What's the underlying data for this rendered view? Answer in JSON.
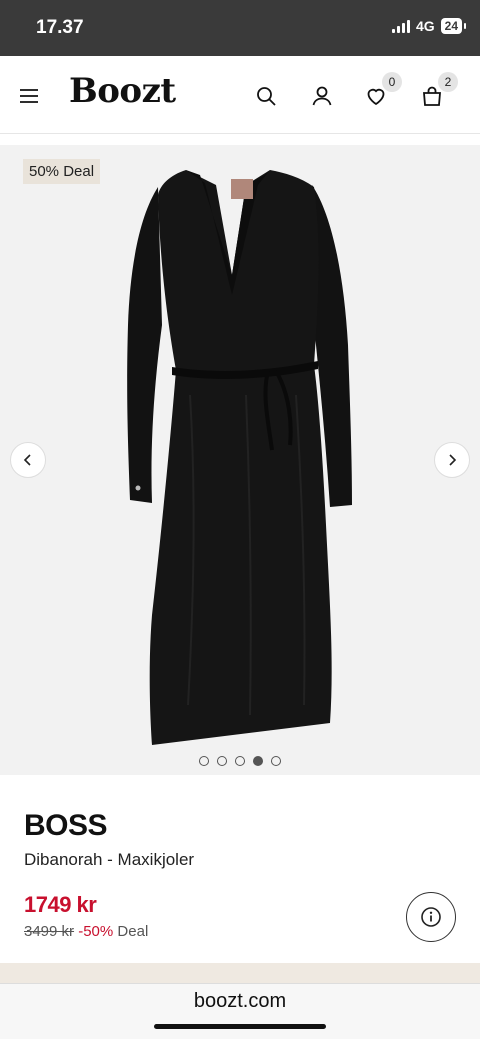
{
  "status_bar": {
    "time": "17.37",
    "network": "4G",
    "battery": "24"
  },
  "header": {
    "logo": "Boozt",
    "wishlist_count": "0",
    "cart_count": "2"
  },
  "gallery": {
    "deal_badge": "50% Deal",
    "image_count": 5,
    "active_index": 3
  },
  "product": {
    "brand": "BOSS",
    "name": "Dibanorah - Maxikjoler",
    "price": "1749 kr",
    "old_price": "3499 kr",
    "discount": "-50%",
    "deal_label": "Deal"
  },
  "browser": {
    "url": "boozt.com"
  },
  "colors": {
    "sale_red": "#c8102e",
    "badge_beige": "#e9e3da"
  }
}
